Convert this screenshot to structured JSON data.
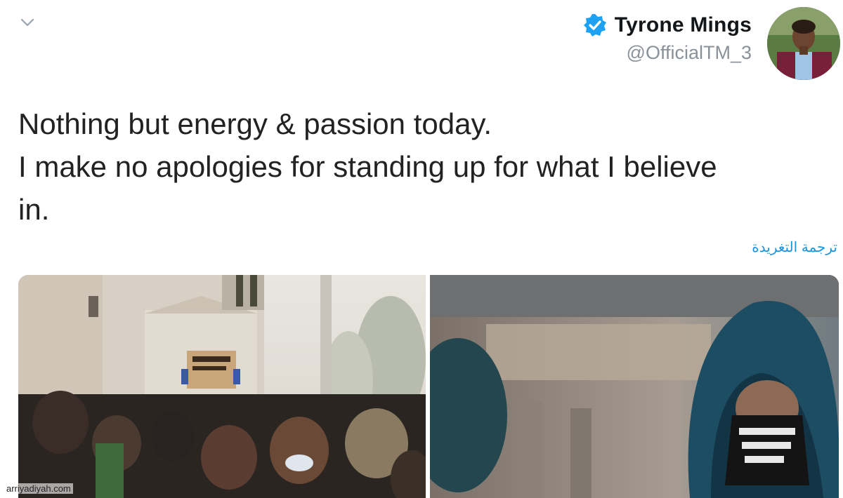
{
  "tweet": {
    "author": {
      "display_name": "Tyrone Mings",
      "handle": "@OfficialTM_3",
      "verified": true,
      "verified_color": "#1da1f2"
    },
    "text_lines": [
      "Nothing but energy & passion today.",
      "I make no apologies for standing up for what I believe",
      "in."
    ],
    "translate_label": "ترجمة التغريدة",
    "media": [
      {
        "icon": "protest-crowd-photo"
      },
      {
        "icon": "hooded-protester-photo"
      }
    ]
  },
  "watermark": "arriyadiyah.com",
  "colors": {
    "link": "#1b95e0",
    "text": "#222222",
    "muted": "#8a9199"
  }
}
